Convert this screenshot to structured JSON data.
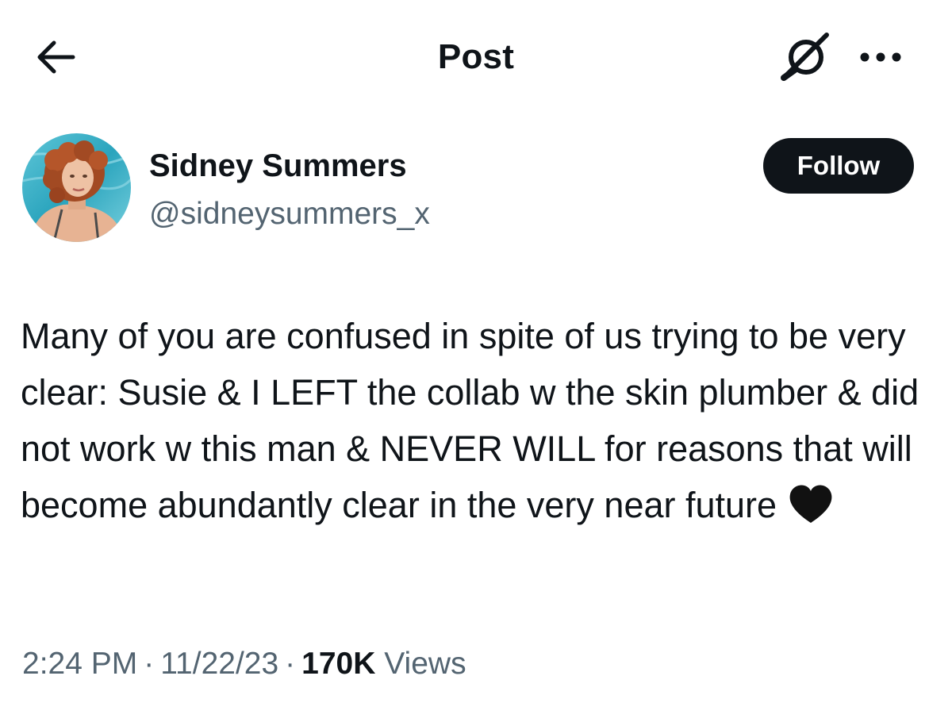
{
  "header": {
    "title": "Post"
  },
  "author": {
    "display_name": "Sidney Summers",
    "handle": "@sidneysummers_x",
    "follow_label": "Follow"
  },
  "post": {
    "text": "Many of you are confused in spite of us trying to be very clear: Susie & I LEFT the collab w the skin plumber & did not work w this man & NEVER WILL for reasons that will become abundantly clear in the very near future",
    "emoji": "black-heart",
    "time": "2:24 PM",
    "date": "11/22/23",
    "separator": "·",
    "views_count": "170K",
    "views_label": "Views"
  },
  "icons": {
    "back": "back-arrow-icon",
    "grok": "grok-icon",
    "more": "more-options-icon"
  },
  "colors": {
    "text_primary": "#0f1419",
    "text_secondary": "#536471",
    "button_bg": "#0f1419",
    "button_text": "#ffffff"
  }
}
